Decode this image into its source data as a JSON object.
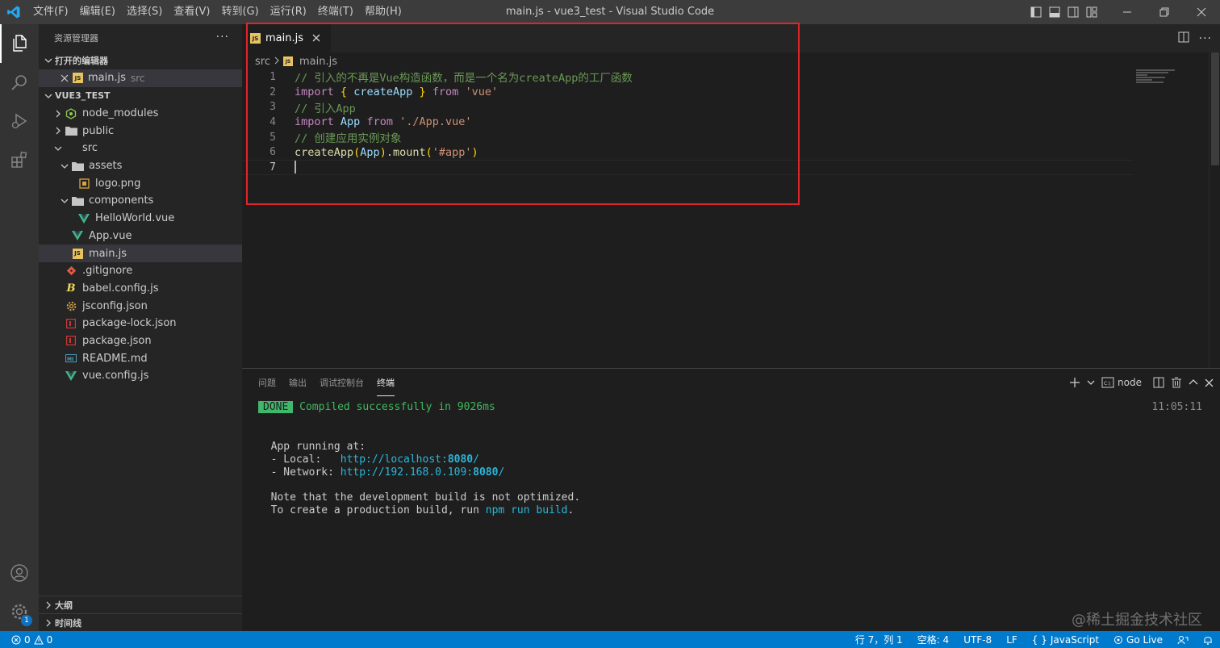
{
  "window": {
    "title": "main.js - vue3_test - Visual Studio Code"
  },
  "menu": [
    "文件(F)",
    "编辑(E)",
    "选择(S)",
    "查看(V)",
    "转到(G)",
    "运行(R)",
    "终端(T)",
    "帮助(H)"
  ],
  "activity": {
    "badge": "1"
  },
  "sidebar": {
    "title": "资源管理器",
    "more": "···",
    "open_editors": {
      "label": "打开的编辑器",
      "items": [
        {
          "name": "main.js",
          "folder": "src"
        }
      ]
    },
    "project": {
      "label": "VUE3_TEST",
      "tree": [
        {
          "name": "node_modules",
          "kind": "folder",
          "expanded": false,
          "depth": 0,
          "icon": "node-folder"
        },
        {
          "name": "public",
          "kind": "folder",
          "expanded": false,
          "depth": 0,
          "icon": "folder"
        },
        {
          "name": "src",
          "kind": "folder",
          "expanded": true,
          "depth": 0,
          "icon": "none"
        },
        {
          "name": "assets",
          "kind": "folder",
          "expanded": true,
          "depth": 1,
          "icon": "folder"
        },
        {
          "name": "logo.png",
          "kind": "file",
          "depth": 2,
          "icon": "image"
        },
        {
          "name": "components",
          "kind": "folder",
          "expanded": true,
          "depth": 1,
          "icon": "folder"
        },
        {
          "name": "HelloWorld.vue",
          "kind": "file",
          "depth": 2,
          "icon": "vue"
        },
        {
          "name": "App.vue",
          "kind": "file",
          "depth": 1,
          "icon": "vue"
        },
        {
          "name": "main.js",
          "kind": "file",
          "depth": 1,
          "icon": "js",
          "selected": true
        },
        {
          "name": ".gitignore",
          "kind": "file",
          "depth": 0,
          "icon": "git"
        },
        {
          "name": "babel.config.js",
          "kind": "file",
          "depth": 0,
          "icon": "babel"
        },
        {
          "name": "jsconfig.json",
          "kind": "file",
          "depth": 0,
          "icon": "gear"
        },
        {
          "name": "package-lock.json",
          "kind": "file",
          "depth": 0,
          "icon": "npm"
        },
        {
          "name": "package.json",
          "kind": "file",
          "depth": 0,
          "icon": "npm"
        },
        {
          "name": "README.md",
          "kind": "file",
          "depth": 0,
          "icon": "markdown"
        },
        {
          "name": "vue.config.js",
          "kind": "file",
          "depth": 0,
          "icon": "vue"
        }
      ]
    },
    "outline_label": "大纲",
    "timeline_label": "时间线"
  },
  "editor": {
    "tab": {
      "label": "main.js"
    },
    "breadcrumb": {
      "folder": "src",
      "file": "main.js"
    },
    "lines": [
      {
        "n": "1",
        "tokens": [
          [
            "c-comment",
            "// 引入的不再是Vue构造函数，而是一个名为createApp的工厂函数"
          ]
        ]
      },
      {
        "n": "2",
        "tokens": [
          [
            "c-kw",
            "import"
          ],
          [
            "c-punc",
            " "
          ],
          [
            "c-br",
            "{"
          ],
          [
            "c-punc",
            " "
          ],
          [
            "c-var",
            "createApp"
          ],
          [
            "c-punc",
            " "
          ],
          [
            "c-br",
            "}"
          ],
          [
            "c-punc",
            " "
          ],
          [
            "c-kw",
            "from"
          ],
          [
            "c-punc",
            " "
          ],
          [
            "c-str",
            "'vue'"
          ]
        ]
      },
      {
        "n": "3",
        "tokens": [
          [
            "c-comment",
            "// 引入App"
          ]
        ]
      },
      {
        "n": "4",
        "tokens": [
          [
            "c-kw",
            "import"
          ],
          [
            "c-punc",
            " "
          ],
          [
            "c-var",
            "App"
          ],
          [
            "c-punc",
            " "
          ],
          [
            "c-kw",
            "from"
          ],
          [
            "c-punc",
            " "
          ],
          [
            "c-str",
            "'./App.vue'"
          ]
        ]
      },
      {
        "n": "5",
        "tokens": [
          [
            "c-comment",
            "// 创建应用实例对象"
          ]
        ]
      },
      {
        "n": "6",
        "tokens": [
          [
            "c-fn",
            "createApp"
          ],
          [
            "c-br",
            "("
          ],
          [
            "c-var",
            "App"
          ],
          [
            "c-br",
            ")"
          ],
          [
            "c-punc",
            "."
          ],
          [
            "c-fn",
            "mount"
          ],
          [
            "c-br",
            "("
          ],
          [
            "c-str",
            "'#app'"
          ],
          [
            "c-br",
            ")"
          ]
        ]
      },
      {
        "n": "7",
        "tokens": [],
        "current": true
      }
    ]
  },
  "panel": {
    "tabs": [
      {
        "label": "问题",
        "active": false
      },
      {
        "label": "输出",
        "active": false
      },
      {
        "label": "调试控制台",
        "active": false
      },
      {
        "label": "终端",
        "active": true
      }
    ],
    "terminal_name": "node",
    "timestamp": "11:05:11",
    "terminal": {
      "done_badge": "DONE",
      "compiled": "Compiled successfully in 9026ms",
      "running": "  App running at:",
      "local_label": "  - Local:   ",
      "local_url_prefix": "http://localhost:",
      "local_port": "8080",
      "local_url_suffix": "/",
      "network_label": "  - Network: ",
      "network_url_prefix": "http://192.168.0.109:",
      "network_port": "8080",
      "network_url_suffix": "/",
      "note": "  Note that the development build is not optimized.",
      "prod_prefix": "  To create a production build, run ",
      "prod_cmd": "npm run build",
      "prod_suffix": "."
    }
  },
  "watermark": "@稀土掘金技术社区",
  "statusbar": {
    "errors": "0",
    "warnings": "0",
    "position": "行 7，列 1",
    "spaces": "空格: 4",
    "encoding": "UTF-8",
    "eol": "LF",
    "language": "JavaScript",
    "golive": "Go Live"
  },
  "colors": {
    "accent": "#007acc",
    "highlight_box": "#e0242c",
    "vue": "#41b883",
    "js": "#e8c35f"
  }
}
